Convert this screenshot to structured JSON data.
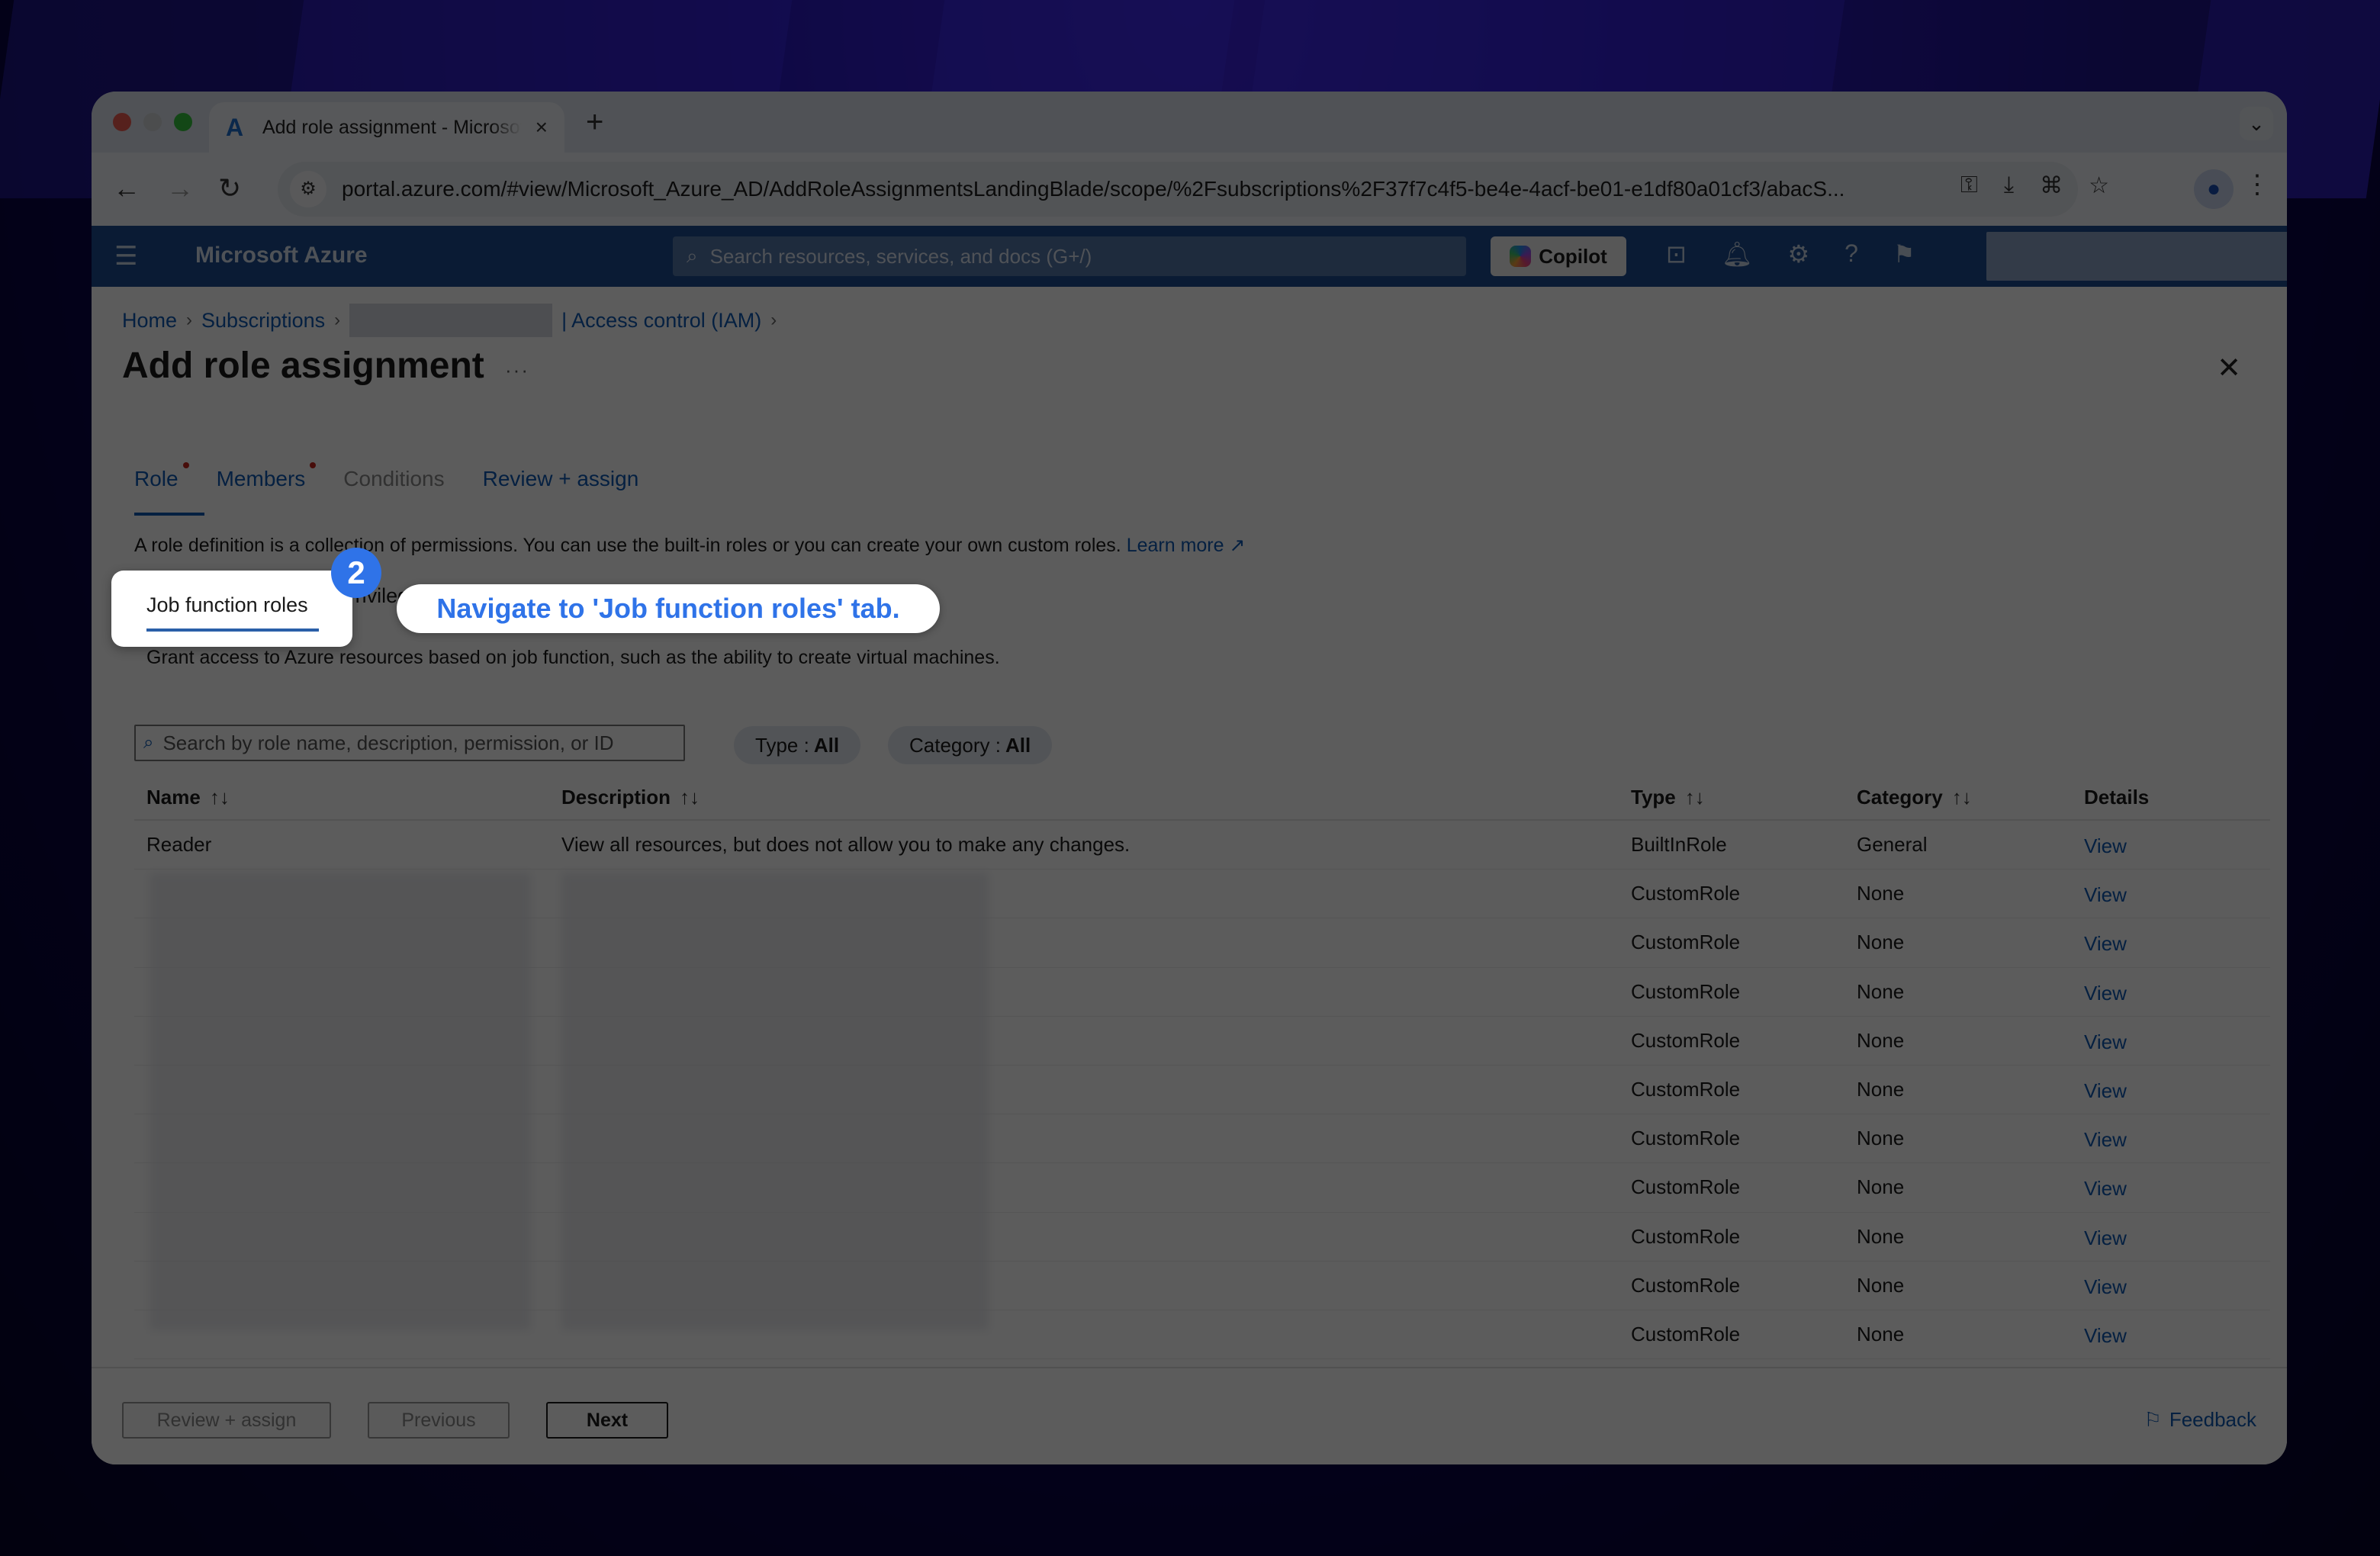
{
  "browser": {
    "tab_title": "Add role assignment - Microsoft Azure",
    "tab_close": "×",
    "new_tab": "+",
    "tab_menu": "⌄",
    "url": "portal.azure.com/#view/Microsoft_Azure_AD/AddRoleAssignmentsLandingBlade/scope/%2Fsubscriptions%2F37f7c4f5-be4e-4acf-be01-e1df80a01cf3/abacS...",
    "back": "←",
    "forward": "→",
    "reload": "↻",
    "site_info": "⚙",
    "addr_icons": [
      "⚿",
      "⤓",
      "⌘",
      "☆"
    ],
    "profile": "●",
    "menu": "⋮"
  },
  "azure_header": {
    "menu_icon": "☰",
    "brand": "Microsoft Azure",
    "search_icon": "⌕",
    "search_placeholder": "Search resources, services, and docs (G+/)",
    "copilot_label": "Copilot",
    "icons": [
      "⊡",
      "🔔︎",
      "⚙",
      "?",
      "⚑"
    ]
  },
  "breadcrumb": {
    "items": [
      "Home",
      "Subscriptions"
    ],
    "last": "| Access control (IAM)",
    "sep": "›"
  },
  "page": {
    "title": "Add role assignment",
    "more": "···",
    "close": "✕"
  },
  "wizard_tabs": [
    {
      "label": "Role",
      "state": "active",
      "required": true
    },
    {
      "label": "Members",
      "state": "normal",
      "required": true
    },
    {
      "label": "Conditions",
      "state": "disabled",
      "required": false
    },
    {
      "label": "Review + assign",
      "state": "normal",
      "required": false
    }
  ],
  "role_description": {
    "text": "A role definition is a collection of permissions. You can use the built-in roles or you can create your own custom roles. ",
    "learn_more": "Learn more ↗"
  },
  "role_tabs": {
    "job_function": "Job function roles",
    "privileged": "Privileged administrator roles"
  },
  "grant_text": "Grant access to Azure resources based on job function, such as the ability to create virtual machines.",
  "filters": {
    "search_icon": "⌕",
    "search_placeholder": "Search by role name, description, permission, or ID",
    "type_label": "Type :",
    "type_value": "All",
    "category_label": "Category :",
    "category_value": "All"
  },
  "table": {
    "columns": {
      "name": "Name",
      "description": "Description",
      "type": "Type",
      "category": "Category",
      "details": "Details",
      "sort_icon": "↑↓"
    },
    "rows": [
      {
        "name": "Reader",
        "description": "View all resources, but does not allow you to make any changes.",
        "type": "BuiltInRole",
        "category": "General",
        "details": "View"
      },
      {
        "name": "",
        "description": "",
        "type": "CustomRole",
        "category": "None",
        "details": "View"
      },
      {
        "name": "",
        "description": "",
        "type": "CustomRole",
        "category": "None",
        "details": "View"
      },
      {
        "name": "",
        "description": "",
        "type": "CustomRole",
        "category": "None",
        "details": "View"
      },
      {
        "name": "",
        "description": "",
        "type": "CustomRole",
        "category": "None",
        "details": "View"
      },
      {
        "name": "",
        "description": "",
        "type": "CustomRole",
        "category": "None",
        "details": "View"
      },
      {
        "name": "",
        "description": "",
        "type": "CustomRole",
        "category": "None",
        "details": "View"
      },
      {
        "name": "",
        "description": "",
        "type": "CustomRole",
        "category": "None",
        "details": "View"
      },
      {
        "name": "",
        "description": "",
        "type": "CustomRole",
        "category": "None",
        "details": "View"
      },
      {
        "name": "",
        "description": "",
        "type": "CustomRole",
        "category": "None",
        "details": "View"
      },
      {
        "name": "",
        "description": "",
        "type": "CustomRole",
        "category": "None",
        "details": "View"
      }
    ]
  },
  "footer": {
    "review_assign": "Review + assign",
    "previous": "Previous",
    "next": "Next",
    "feedback_icon": "⚐",
    "feedback": "Feedback"
  },
  "annotation": {
    "step": "2",
    "instruction": "Navigate to 'Job function roles' tab."
  },
  "colors": {
    "azure_header": "#1e4d91",
    "link": "#0f5ab4",
    "callout_accent": "#2f73e8",
    "required_dot": "#c4261c"
  }
}
